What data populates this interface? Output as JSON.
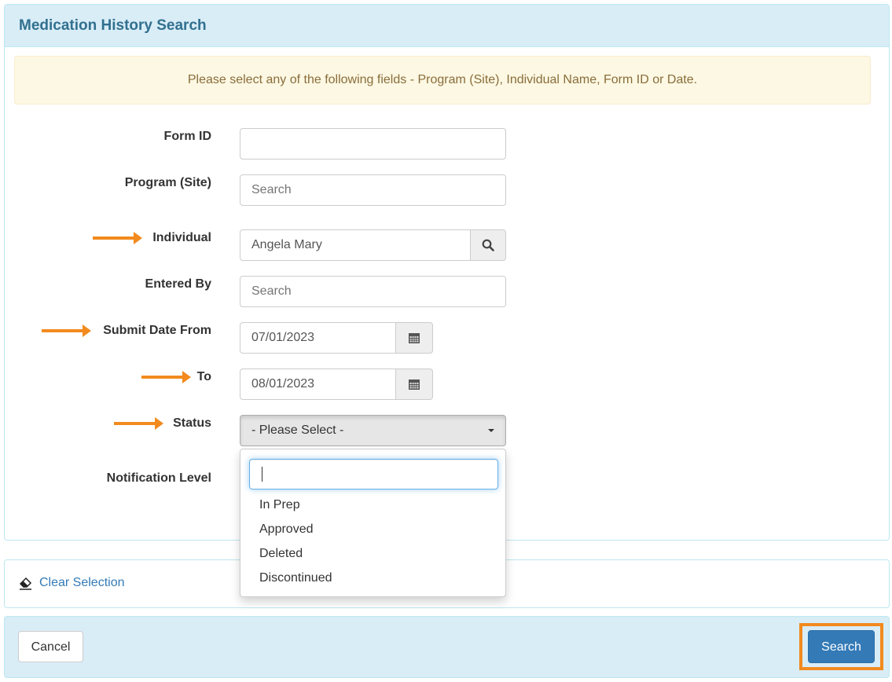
{
  "header": {
    "title": "Medication History Search"
  },
  "alert": {
    "message": "Please select any of the following fields - Program (Site), Individual Name, Form ID or Date."
  },
  "form": {
    "form_id": {
      "label": "Form ID",
      "value": ""
    },
    "program": {
      "label": "Program (Site)",
      "placeholder": "Search"
    },
    "individual": {
      "label": "Individual",
      "value": "Angela Mary"
    },
    "entered_by": {
      "label": "Entered By",
      "placeholder": "Search"
    },
    "submit_date_from": {
      "label": "Submit Date From",
      "value": "07/01/2023"
    },
    "submit_date_to": {
      "label": "To",
      "value": "08/01/2023"
    },
    "status": {
      "label": "Status",
      "selected": "- Please Select -",
      "search_value": "",
      "options": [
        "In Prep",
        "Approved",
        "Deleted",
        "Discontinued"
      ]
    },
    "notification_level": {
      "label": "Notification Level"
    }
  },
  "actions": {
    "clear_selection": "Clear Selection",
    "cancel": "Cancel",
    "search": "Search"
  },
  "colors": {
    "accent_arrow": "#f28a1e",
    "primary": "#337ab7",
    "panel_heading": "#d9edf7",
    "alert_bg": "#fcf8e3"
  }
}
